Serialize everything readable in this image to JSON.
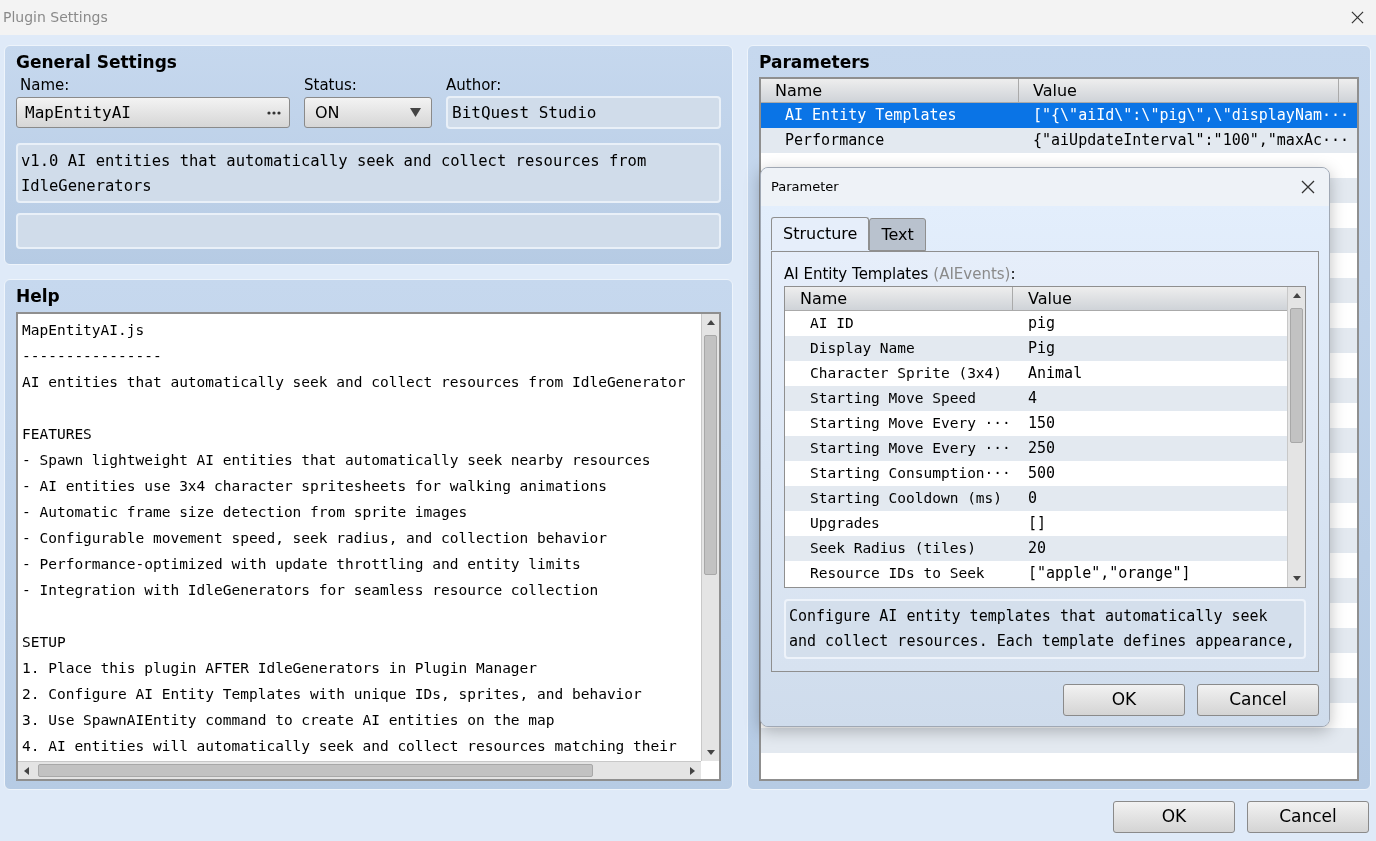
{
  "window": {
    "title": "Plugin Settings"
  },
  "general": {
    "title": "General Settings",
    "name": {
      "label": "Name:",
      "value": "MapEntityAI"
    },
    "status": {
      "label": "Status:",
      "value": "ON"
    },
    "author": {
      "label": "Author:",
      "value": "BitQuest Studio"
    },
    "description": "v1.0 AI entities that automatically seek and collect resources from IdleGenerators"
  },
  "help": {
    "title": "Help",
    "sections": [
      {
        "lines": [
          "MapEntityAI.js",
          "----------------",
          "AI entities that automatically seek and collect resources from IdleGenerator"
        ]
      },
      {
        "lines": [
          "FEATURES",
          "- Spawn lightweight AI entities that automatically seek nearby resources",
          "- AI entities use 3x4 character spritesheets for walking animations",
          "- Automatic frame size detection from sprite images",
          "- Configurable movement speed, seek radius, and collection behavior",
          "- Performance-optimized with update throttling and entity limits",
          "- Integration with IdleGenerators for seamless resource collection"
        ]
      },
      {
        "lines": [
          "SETUP",
          "1. Place this plugin AFTER IdleGenerators in Plugin Manager",
          "2. Configure AI Entity Templates with unique IDs, sprites, and behavior",
          "3. Use SpawnAIEntity command to create AI entities on the map",
          "4. AI entities will automatically seek and collect resources matching their"
        ]
      }
    ]
  },
  "parameters": {
    "title": "Parameters",
    "columns": [
      "Name",
      "Value"
    ],
    "rows": [
      {
        "name": "AI Entity Templates",
        "value": "[\"{\\\"aiId\\\":\\\"pig\\\",\\\"displayNam···",
        "selected": true
      },
      {
        "name": "Performance",
        "value": "{\"aiUpdateInterval\":\"100\",\"maxAc···",
        "selected": false
      }
    ]
  },
  "dialog": {
    "title": "Parameter",
    "tabs": [
      {
        "label": "Structure",
        "selected": true
      },
      {
        "label": "Text",
        "selected": false
      }
    ],
    "label": "AI Entity Templates",
    "label_type": "(AIEvents)",
    "label_end": ":",
    "columns": [
      "Name",
      "Value"
    ],
    "rows": [
      {
        "name": "AI ID",
        "value": "pig"
      },
      {
        "name": "Display Name",
        "value": "Pig"
      },
      {
        "name": "Character Sprite (3x4)",
        "value": "Animal"
      },
      {
        "name": "Starting Move Speed",
        "value": "4"
      },
      {
        "name": "Starting Move Every ···",
        "value": "150"
      },
      {
        "name": "Starting Move Every ···",
        "value": "250"
      },
      {
        "name": "Starting Consumption···",
        "value": "500"
      },
      {
        "name": "Starting Cooldown (ms)",
        "value": "0"
      },
      {
        "name": "Upgrades",
        "value": "[]"
      },
      {
        "name": "Seek Radius (tiles)",
        "value": "20"
      },
      {
        "name": "Resource IDs to Seek",
        "value": "[\"apple\",\"orange\"]"
      }
    ],
    "description": "Configure AI entity templates that automatically seek and collect resources. Each template defines appearance,",
    "buttons": [
      "OK",
      "Cancel"
    ]
  },
  "buttons": [
    "OK",
    "Cancel"
  ]
}
